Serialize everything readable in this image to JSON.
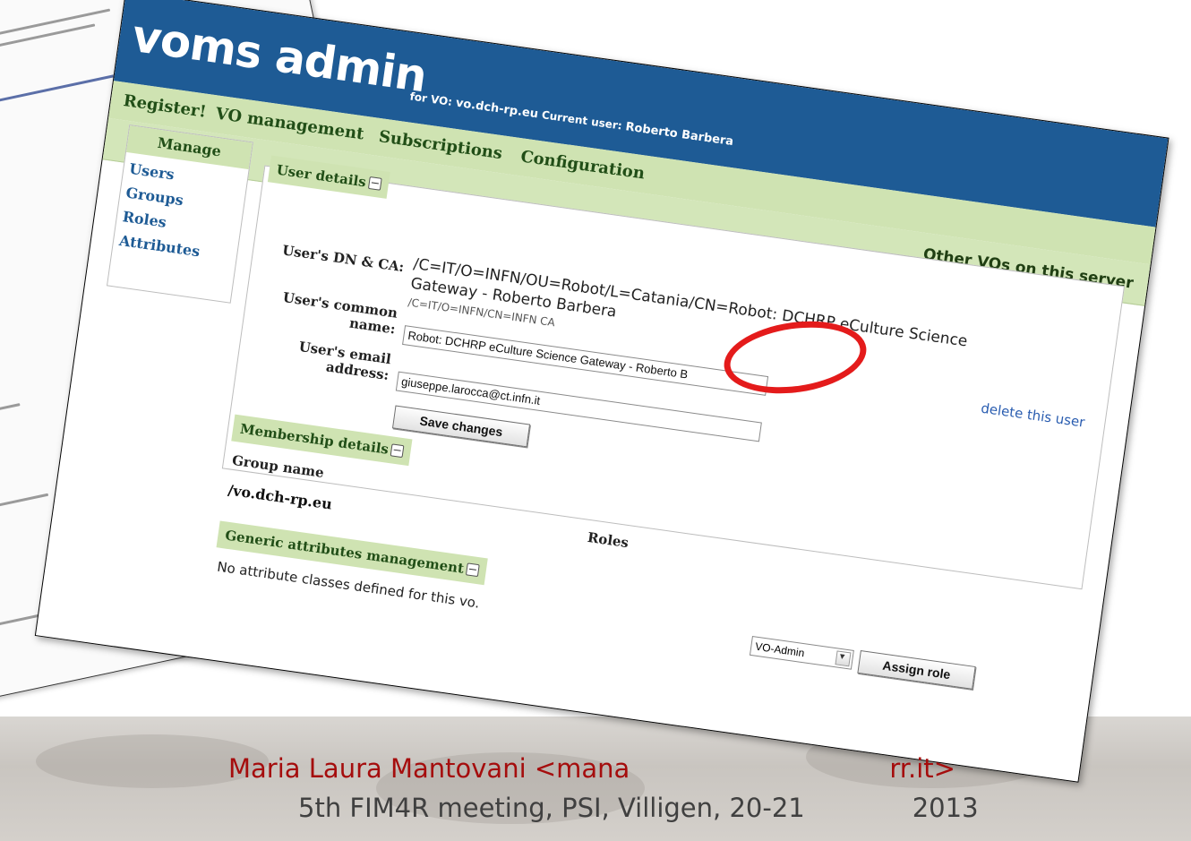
{
  "banner": {
    "logo": "voms admin",
    "for_label": "for VO:",
    "vo_name": "vo.dch-rp.eu",
    "current_user_label": "Current user:",
    "current_user": "Roberto Barbera"
  },
  "nav": {
    "items": [
      "Register!",
      "VO management",
      "Subscriptions",
      "Configuration"
    ]
  },
  "other_vos": "Other VOs on this server",
  "manage": {
    "title": "Manage",
    "items": [
      "Users",
      "Groups",
      "Roles",
      "Attributes"
    ]
  },
  "user_details": {
    "title": "User details",
    "dn_label": "User's DN & CA:",
    "dn_line1": "/C=IT/O=INFN/OU=Robot/L=Catania/CN=Robot: DCHRP eCulture Science",
    "dn_line2": "Gateway - Roberto Barbera",
    "ca": "/C=IT/O=INFN/CN=INFN CA",
    "common_name_label_1": "User's common",
    "common_name_label_2": "name:",
    "common_name_value": "Robot: DCHRP eCulture Science Gateway  - Roberto B",
    "email_label_1": "User's email",
    "email_label_2": "address:",
    "email_value": "giuseppe.larocca@ct.infn.it",
    "save_button": "Save changes",
    "delete_link": "delete this user"
  },
  "membership": {
    "title": "Membership details",
    "group_col": "Group name",
    "roles_col": "Roles",
    "group": "/vo.dch-rp.eu",
    "role_select": "VO-Admin",
    "assign_button": "Assign role"
  },
  "attributes": {
    "title": "Generic attributes management",
    "empty_message": "No attribute classes defined for this vo."
  },
  "footer": {
    "line1": "Maria Laura Mantovani <mana",
    "line1_end": "rr.it>",
    "line2": "5th FIM4R meeting, PSI, Villigen, 20-21",
    "line2_end": "2013"
  },
  "colors": {
    "banner": "#1e5b95",
    "nav_bar": "#cfe3b2",
    "annotation": "#e41b1b",
    "footer_name": "#a50d0d"
  }
}
